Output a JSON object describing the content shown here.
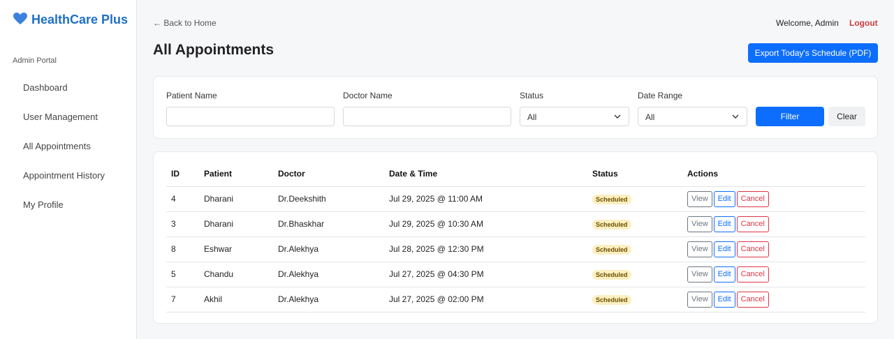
{
  "brand": {
    "name": "HealthCare Plus",
    "subtitle": "Admin Portal",
    "icon": "heart-icon",
    "color": "#1f6fc6"
  },
  "sidebar": {
    "items": [
      {
        "label": "Dashboard"
      },
      {
        "label": "User Management"
      },
      {
        "label": "All Appointments"
      },
      {
        "label": "Appointment History"
      },
      {
        "label": "My Profile"
      }
    ]
  },
  "header": {
    "back_label": "← Back to Home",
    "welcome": "Welcome, Admin",
    "logout": "Logout",
    "title": "All Appointments",
    "export_label": "Export Today's Schedule (PDF)"
  },
  "filters": {
    "patient_label": "Patient Name",
    "patient_value": "",
    "doctor_label": "Doctor Name",
    "doctor_value": "",
    "status_label": "Status",
    "status_value": "All",
    "date_label": "Date Range",
    "date_value": "All",
    "filter_button": "Filter",
    "clear_button": "Clear"
  },
  "table": {
    "headers": [
      "ID",
      "Patient",
      "Doctor",
      "Date & Time",
      "Status",
      "Actions"
    ],
    "actions": {
      "view": "View",
      "edit": "Edit",
      "cancel": "Cancel"
    },
    "rows": [
      {
        "id": "4",
        "patient": "Dharani",
        "doctor": "Dr.Deekshith",
        "datetime": "Jul 29, 2025 @ 11:00 AM",
        "status": "Scheduled"
      },
      {
        "id": "3",
        "patient": "Dharani",
        "doctor": "Dr.Bhaskhar",
        "datetime": "Jul 29, 2025 @ 10:30 AM",
        "status": "Scheduled"
      },
      {
        "id": "8",
        "patient": "Eshwar",
        "doctor": "Dr.Alekhya",
        "datetime": "Jul 28, 2025 @ 12:30 PM",
        "status": "Scheduled"
      },
      {
        "id": "5",
        "patient": "Chandu",
        "doctor": "Dr.Alekhya",
        "datetime": "Jul 27, 2025 @ 04:30 PM",
        "status": "Scheduled"
      },
      {
        "id": "7",
        "patient": "Akhil",
        "doctor": "Dr.Alekhya",
        "datetime": "Jul 27, 2025 @ 02:00 PM",
        "status": "Scheduled"
      }
    ]
  }
}
